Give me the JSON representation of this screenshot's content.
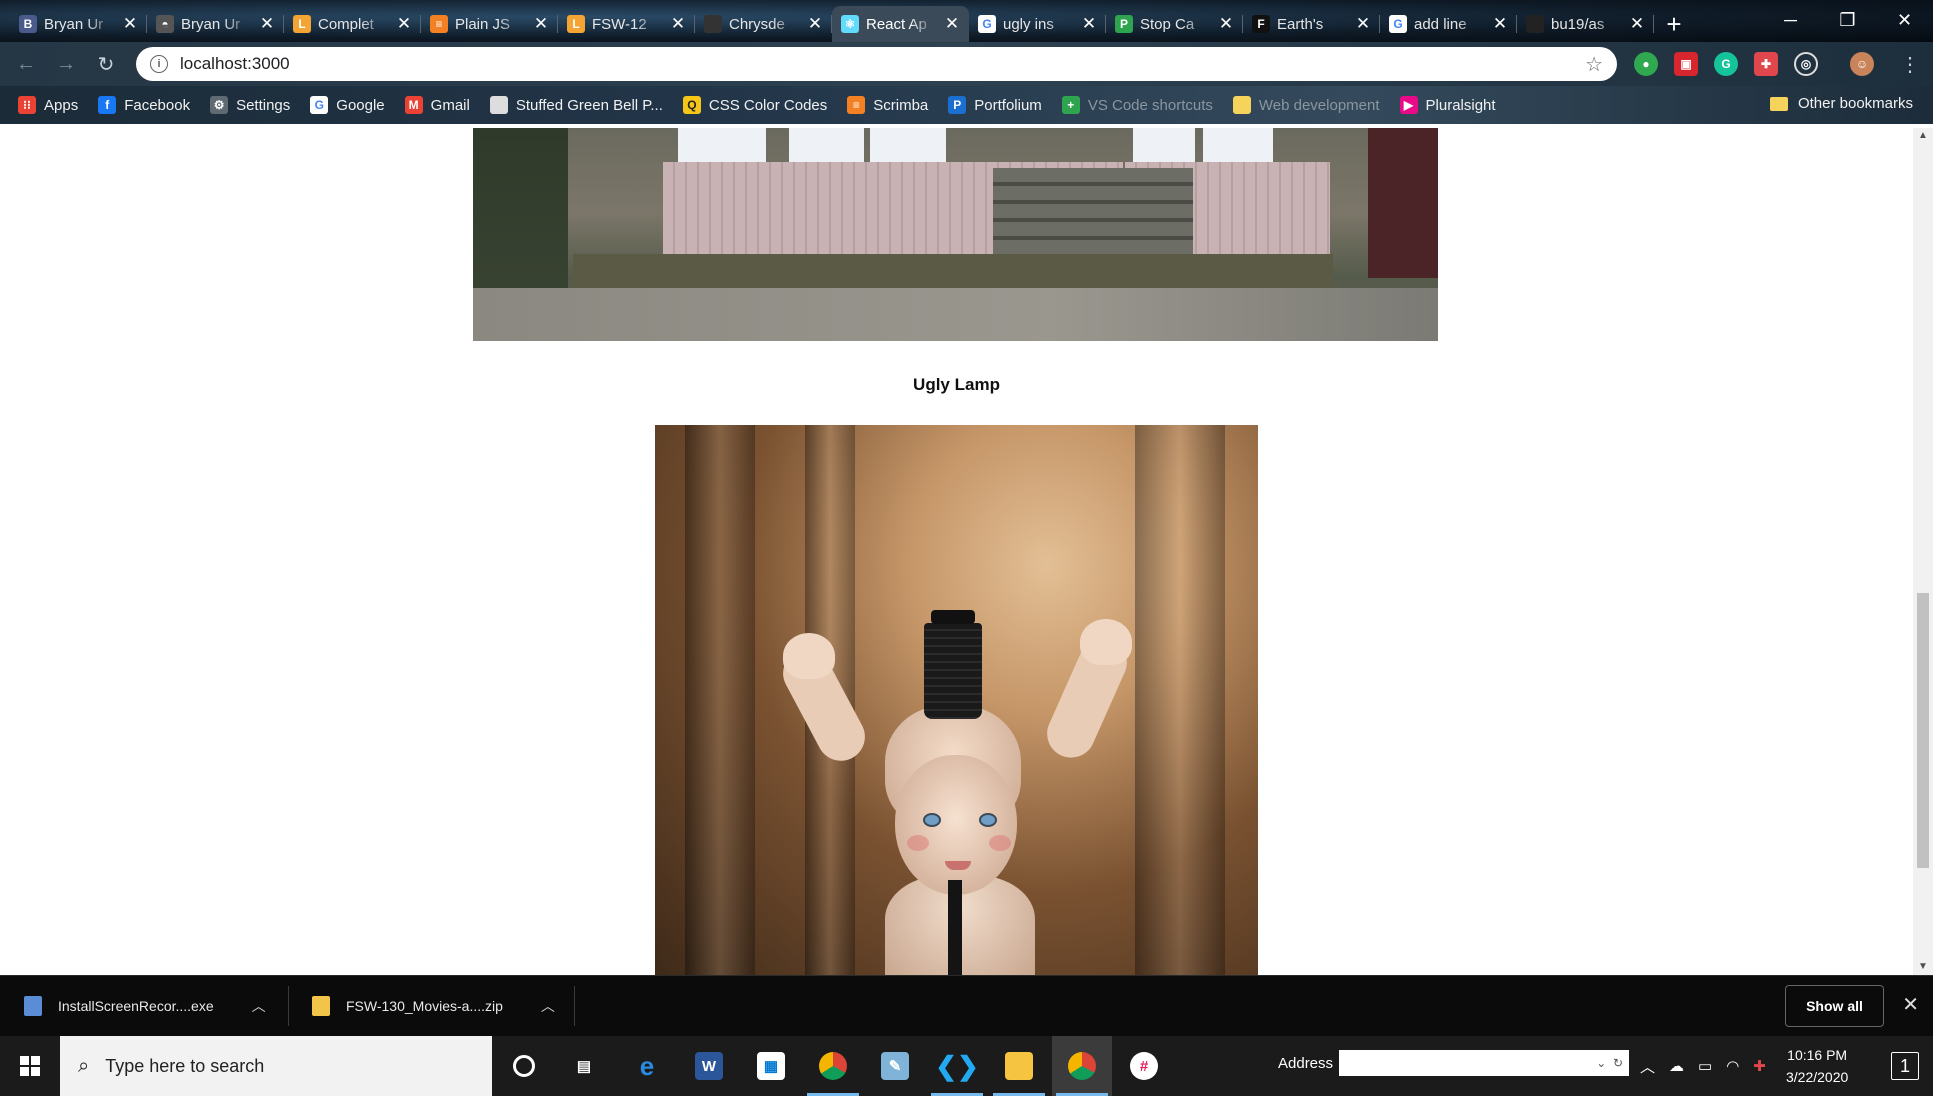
{
  "tabs": [
    {
      "title": "Bryan Ur",
      "icon": "app-icon",
      "color": "#4a5a8a",
      "glyph": "B"
    },
    {
      "title": "Bryan Ur",
      "icon": "github-icon",
      "color": "#555555",
      "glyph": "◓"
    },
    {
      "title": "Complet",
      "icon": "document-icon",
      "color": "#f4a433",
      "glyph": "L"
    },
    {
      "title": "Plain JS",
      "icon": "stack-icon",
      "color": "#f48024",
      "glyph": "≡"
    },
    {
      "title": "FSW-12",
      "icon": "document-icon",
      "color": "#f4a433",
      "glyph": "L"
    },
    {
      "title": "Chrysde",
      "icon": "page-icon",
      "color": "#333333",
      "glyph": ""
    },
    {
      "title": "React Ap",
      "icon": "react-icon",
      "color": "#61dafb",
      "glyph": "⚛"
    },
    {
      "title": "ugly ins",
      "icon": "google-icon",
      "color": "#ffffff",
      "glyph": "G"
    },
    {
      "title": "Stop Ca",
      "icon": "p-icon",
      "color": "#2ea44f",
      "glyph": "P"
    },
    {
      "title": "Earth's",
      "icon": "f-icon",
      "color": "#111111",
      "glyph": "F"
    },
    {
      "title": "add line",
      "icon": "google-icon",
      "color": "#ffffff",
      "glyph": "G"
    },
    {
      "title": "bu19/as",
      "icon": "github-icon",
      "color": "#222222",
      "glyph": ""
    }
  ],
  "new_tab_label": "+",
  "window_controls": {
    "minimize": "─",
    "restore": "❐",
    "close": "✕"
  },
  "toolbar": {
    "back": "←",
    "forward": "→",
    "reload": "↻",
    "url": "localhost:3000",
    "info": "i",
    "star": "☆",
    "menu": "⋮"
  },
  "bookmarks": [
    {
      "label": "Apps",
      "icon": "apps-grid-icon",
      "color": "#ea4335",
      "glyph": "⁝⁝"
    },
    {
      "label": "Facebook",
      "icon": "facebook-icon",
      "color": "#1877f2",
      "glyph": "f"
    },
    {
      "label": "Settings",
      "icon": "gear-icon",
      "color": "#5f6a73",
      "glyph": "⚙"
    },
    {
      "label": "Google",
      "icon": "google-icon",
      "color": "#ffffff",
      "glyph": "G"
    },
    {
      "label": "Gmail",
      "icon": "gmail-icon",
      "color": "#ea4335",
      "glyph": "M"
    },
    {
      "label": "Stuffed Green Bell P...",
      "icon": "page-icon",
      "color": "#dddddd",
      "glyph": ""
    },
    {
      "label": "CSS Color Codes",
      "icon": "q-icon",
      "color": "#f5c518",
      "glyph": "Q"
    },
    {
      "label": "Scrimba",
      "icon": "stack-icon",
      "color": "#f48024",
      "glyph": "≡"
    },
    {
      "label": "Portfolium",
      "icon": "p-icon",
      "color": "#1a6fd1",
      "glyph": "P"
    },
    {
      "label": "VS Code shortcuts",
      "icon": "plus-icon",
      "color": "#2ea44f",
      "glyph": "+",
      "faded": true
    },
    {
      "label": "Web development",
      "icon": "folder-icon",
      "color": "#f6d35b",
      "glyph": "",
      "faded": true
    },
    {
      "label": "Pluralsight",
      "icon": "pluralsight-icon",
      "color": "#e80a89",
      "glyph": "▶"
    }
  ],
  "other_bookmarks": "Other bookmarks",
  "page": {
    "item_title": "Ugly Lamp"
  },
  "downloads": [
    {
      "name": "InstallScreenRecor....exe",
      "icon": "installer-icon",
      "color": "#5b8cd6"
    },
    {
      "name": "FSW-130_Movies-a....zip",
      "icon": "zip-icon",
      "color": "#f3c44a"
    }
  ],
  "show_all": "Show all",
  "taskbar": {
    "search_placeholder": "Type here to search",
    "address_label": "Address",
    "time": "10:16 PM",
    "date": "3/22/2020",
    "notifications_count": "1"
  }
}
